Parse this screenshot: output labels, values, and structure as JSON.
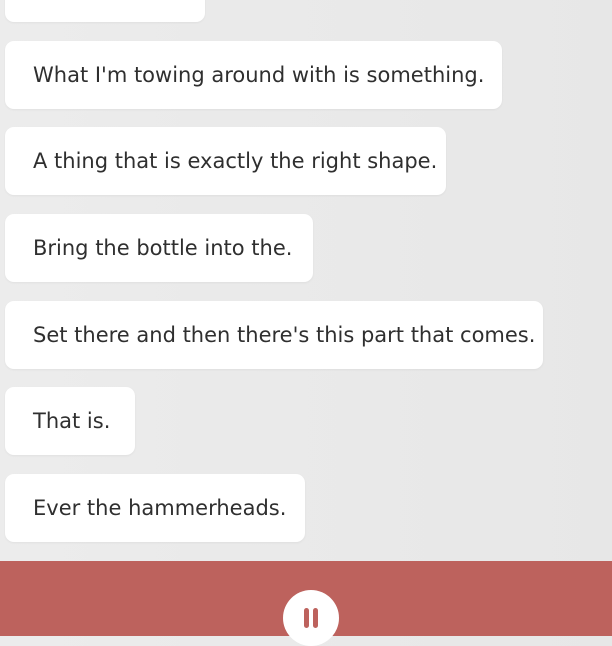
{
  "transcript": {
    "messages": [
      {
        "text": ""
      },
      {
        "text": "What I'm towing around with is something."
      },
      {
        "text": "A thing that is exactly the right shape."
      },
      {
        "text": "Bring the bottle into the."
      },
      {
        "text": "Set there and then there's this part that comes."
      },
      {
        "text": "That is."
      },
      {
        "text": "Ever the hammerheads."
      }
    ]
  },
  "controls": {
    "pause_icon": "pause-icon",
    "bar_color": "#bd625d"
  }
}
